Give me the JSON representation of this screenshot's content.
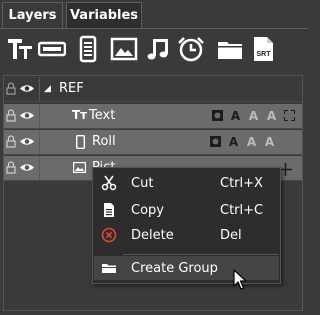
{
  "tabs": [
    {
      "label": "Layers",
      "active": true
    },
    {
      "label": "Variables",
      "active": false
    }
  ],
  "toolbar": {
    "items": [
      {
        "icon": "text-icon"
      },
      {
        "icon": "roll-bar-icon"
      },
      {
        "icon": "crawl-document-icon"
      },
      {
        "icon": "picture-icon"
      },
      {
        "icon": "music-note-icon"
      },
      {
        "icon": "alarm-clock-icon"
      },
      {
        "icon": "folder-icon"
      },
      {
        "icon": "srt-file-icon",
        "badge": "SRT"
      }
    ]
  },
  "layers": [
    {
      "name": "REF",
      "type": "group",
      "expanded_glyph": "◢"
    },
    {
      "name": "Text",
      "type": "text",
      "type_glyph": "Tт",
      "flags": [
        "A",
        "A",
        "A"
      ]
    },
    {
      "name": "Roll",
      "type": "roll",
      "flags": [
        "A",
        "A",
        "A"
      ]
    },
    {
      "name": "Pict",
      "type": "picture"
    }
  ],
  "context_menu": {
    "items": [
      {
        "label": "Cut",
        "shortcut": "Ctrl+X",
        "icon": "scissors-icon"
      },
      {
        "label": "Copy",
        "shortcut": "Ctrl+C",
        "icon": "copy-icon"
      },
      {
        "label": "Delete",
        "shortcut": "Del",
        "icon": "delete-circle-icon"
      },
      {
        "label": "Create Group",
        "shortcut": "",
        "icon": "folder-icon",
        "highlighted": true
      }
    ]
  },
  "colors": {
    "panel_bg": "#3a3a3a",
    "selected_row": "#6b6b6b",
    "menu_bg": "#2d2d2d",
    "delete_red": "#e0443a"
  }
}
